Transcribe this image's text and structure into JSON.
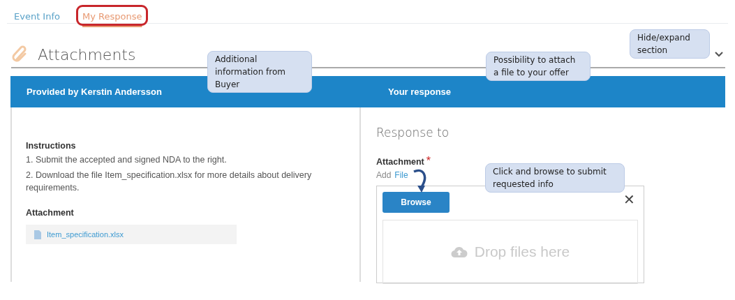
{
  "tabs": [
    {
      "label": "Event Info",
      "selected": false,
      "highlighted": false
    },
    {
      "label": "My Response",
      "selected": true,
      "highlighted": true
    }
  ],
  "section": {
    "title": "Attachments",
    "expanded": true
  },
  "left": {
    "header": "Provided by Kerstin Andersson",
    "instructions_title": "Instructions",
    "instructions": [
      "1. Submit the accepted and signed NDA to the right.",
      "2. Download the file Item_specification.xlsx for more details about delivery requirements."
    ],
    "attachment_title": "Attachment",
    "file": "Item_specification.xlsx"
  },
  "right": {
    "header": "Your response",
    "heading": "Response to",
    "field_label": "Attachment",
    "required": true,
    "required_mark": "*",
    "add_prefix": "Add",
    "add_link": "File",
    "browse": "Browse",
    "close": "✕",
    "drop": "Drop files here"
  },
  "callouts": [
    {
      "text": "Additional information from Buyer"
    },
    {
      "text": "Possibility to attach a file to your offer"
    },
    {
      "text": "Hide/expand section"
    },
    {
      "text": "Click and browse to submit requested info"
    }
  ]
}
